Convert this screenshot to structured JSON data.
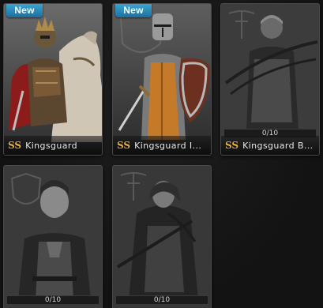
{
  "cards": [
    {
      "new_badge": "New",
      "rank": "SS",
      "name": "Kingsguard",
      "class_icon": "horse-icon"
    },
    {
      "new_badge": "New",
      "rank": "SS",
      "name": "Kingsguard I...",
      "class_icon": "shield-icon"
    },
    {
      "rank": "SS",
      "name": "Kingsguard B...",
      "class_icon": "crossbow-icon",
      "progress_text": "0/10",
      "progress": 0
    },
    {
      "class_icon": "shield-icon",
      "progress_text": "0/10",
      "progress": 0
    },
    {
      "class_icon": "crossbow-icon",
      "progress_text": "0/10",
      "progress": 0
    }
  ],
  "colors": {
    "new_badge": "#2a8cc0",
    "rank_gold": "#e6b03a",
    "name_text": "#e8e8e8"
  }
}
